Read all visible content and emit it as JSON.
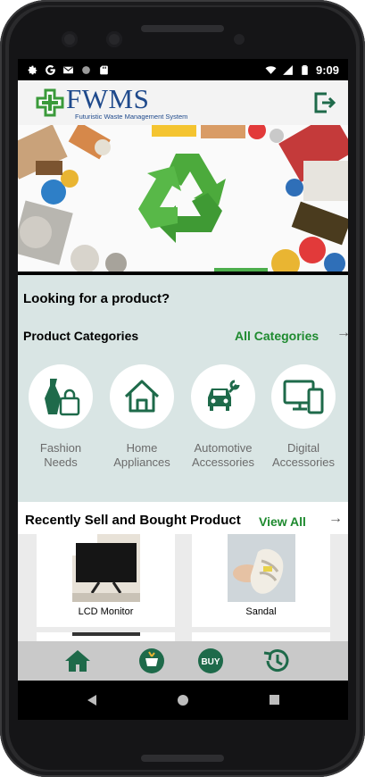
{
  "status_bar": {
    "time": "9:09",
    "left_icons": [
      "gear-icon",
      "google-icon",
      "gmail-icon",
      "circle-icon",
      "sd-card-icon"
    ],
    "right_icons": [
      "wifi-icon",
      "signal-icon",
      "battery-icon"
    ]
  },
  "app": {
    "logo_title": "FWMS",
    "logo_subtitle": "Futuristic Waste Management System",
    "logout_icon": "logout-icon"
  },
  "banner": {
    "icon": "recycle-icon"
  },
  "main": {
    "looking_text": "Looking for a product?",
    "categories_title": "Product Categories",
    "categories_all": "All Categories",
    "categories": [
      {
        "label_line1": "Fashion",
        "label_line2": "Needs",
        "icon": "fashion-icon"
      },
      {
        "label_line1": "Home",
        "label_line2": "Appliances",
        "icon": "home-icon"
      },
      {
        "label_line1": "Automotive",
        "label_line2": "Accessories",
        "icon": "car-wrench-icon"
      },
      {
        "label_line1": "Digital",
        "label_line2": "Accessories",
        "icon": "devices-icon"
      }
    ]
  },
  "recent": {
    "title": "Recently Sell and Bought Product",
    "view_all": "View All",
    "products": [
      {
        "name": "LCD Monitor"
      },
      {
        "name": "Sandal"
      }
    ]
  },
  "bottom_nav": {
    "buy_label": "BUY",
    "items": [
      "home-icon",
      "sell-icon",
      "buy-icon",
      "history-icon"
    ]
  },
  "colors": {
    "accent_green": "#1e8a2f",
    "dark_green": "#1e6a4a",
    "brand_blue": "#1f4a8c",
    "content_bg": "#d9e5e4"
  }
}
